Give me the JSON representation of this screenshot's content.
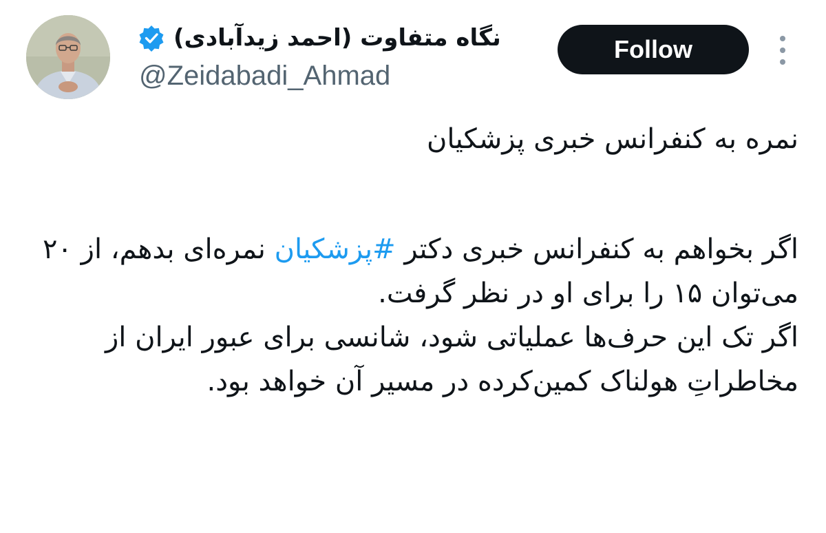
{
  "author": {
    "display_name": "نگاه متفاوت (احمد زیدآبادی)",
    "handle": "@Zeidabadi_Ahmad",
    "verified": true,
    "verified_icon": "verified-badge-icon",
    "avatar_icon": "profile-photo"
  },
  "actions": {
    "follow_label": "Follow",
    "more_icon": "more-options-icon"
  },
  "tweet": {
    "title_line": "نمره به کنفرانس خبری پزشکیان",
    "para1_before": "اگر بخواهم به کنفرانس خبری دکتر ",
    "hashtag": "#پزشکیان",
    "para1_after": " نمره‌ای بدهم، از ۲۰ می‌توان ۱۵ را برای او در نظر گرفت.",
    "para2": "اگر تک این حرف‌ها عملیاتی شود، شانسی برای عبور ایران از مخاطراتِ هولناک کمین‌کرده در مسیر آن خواهد بود."
  },
  "colors": {
    "hashtag": "#1d9bf0",
    "follow_bg": "#0f1419",
    "verified": "#1d9bf0",
    "handle": "#536471"
  }
}
